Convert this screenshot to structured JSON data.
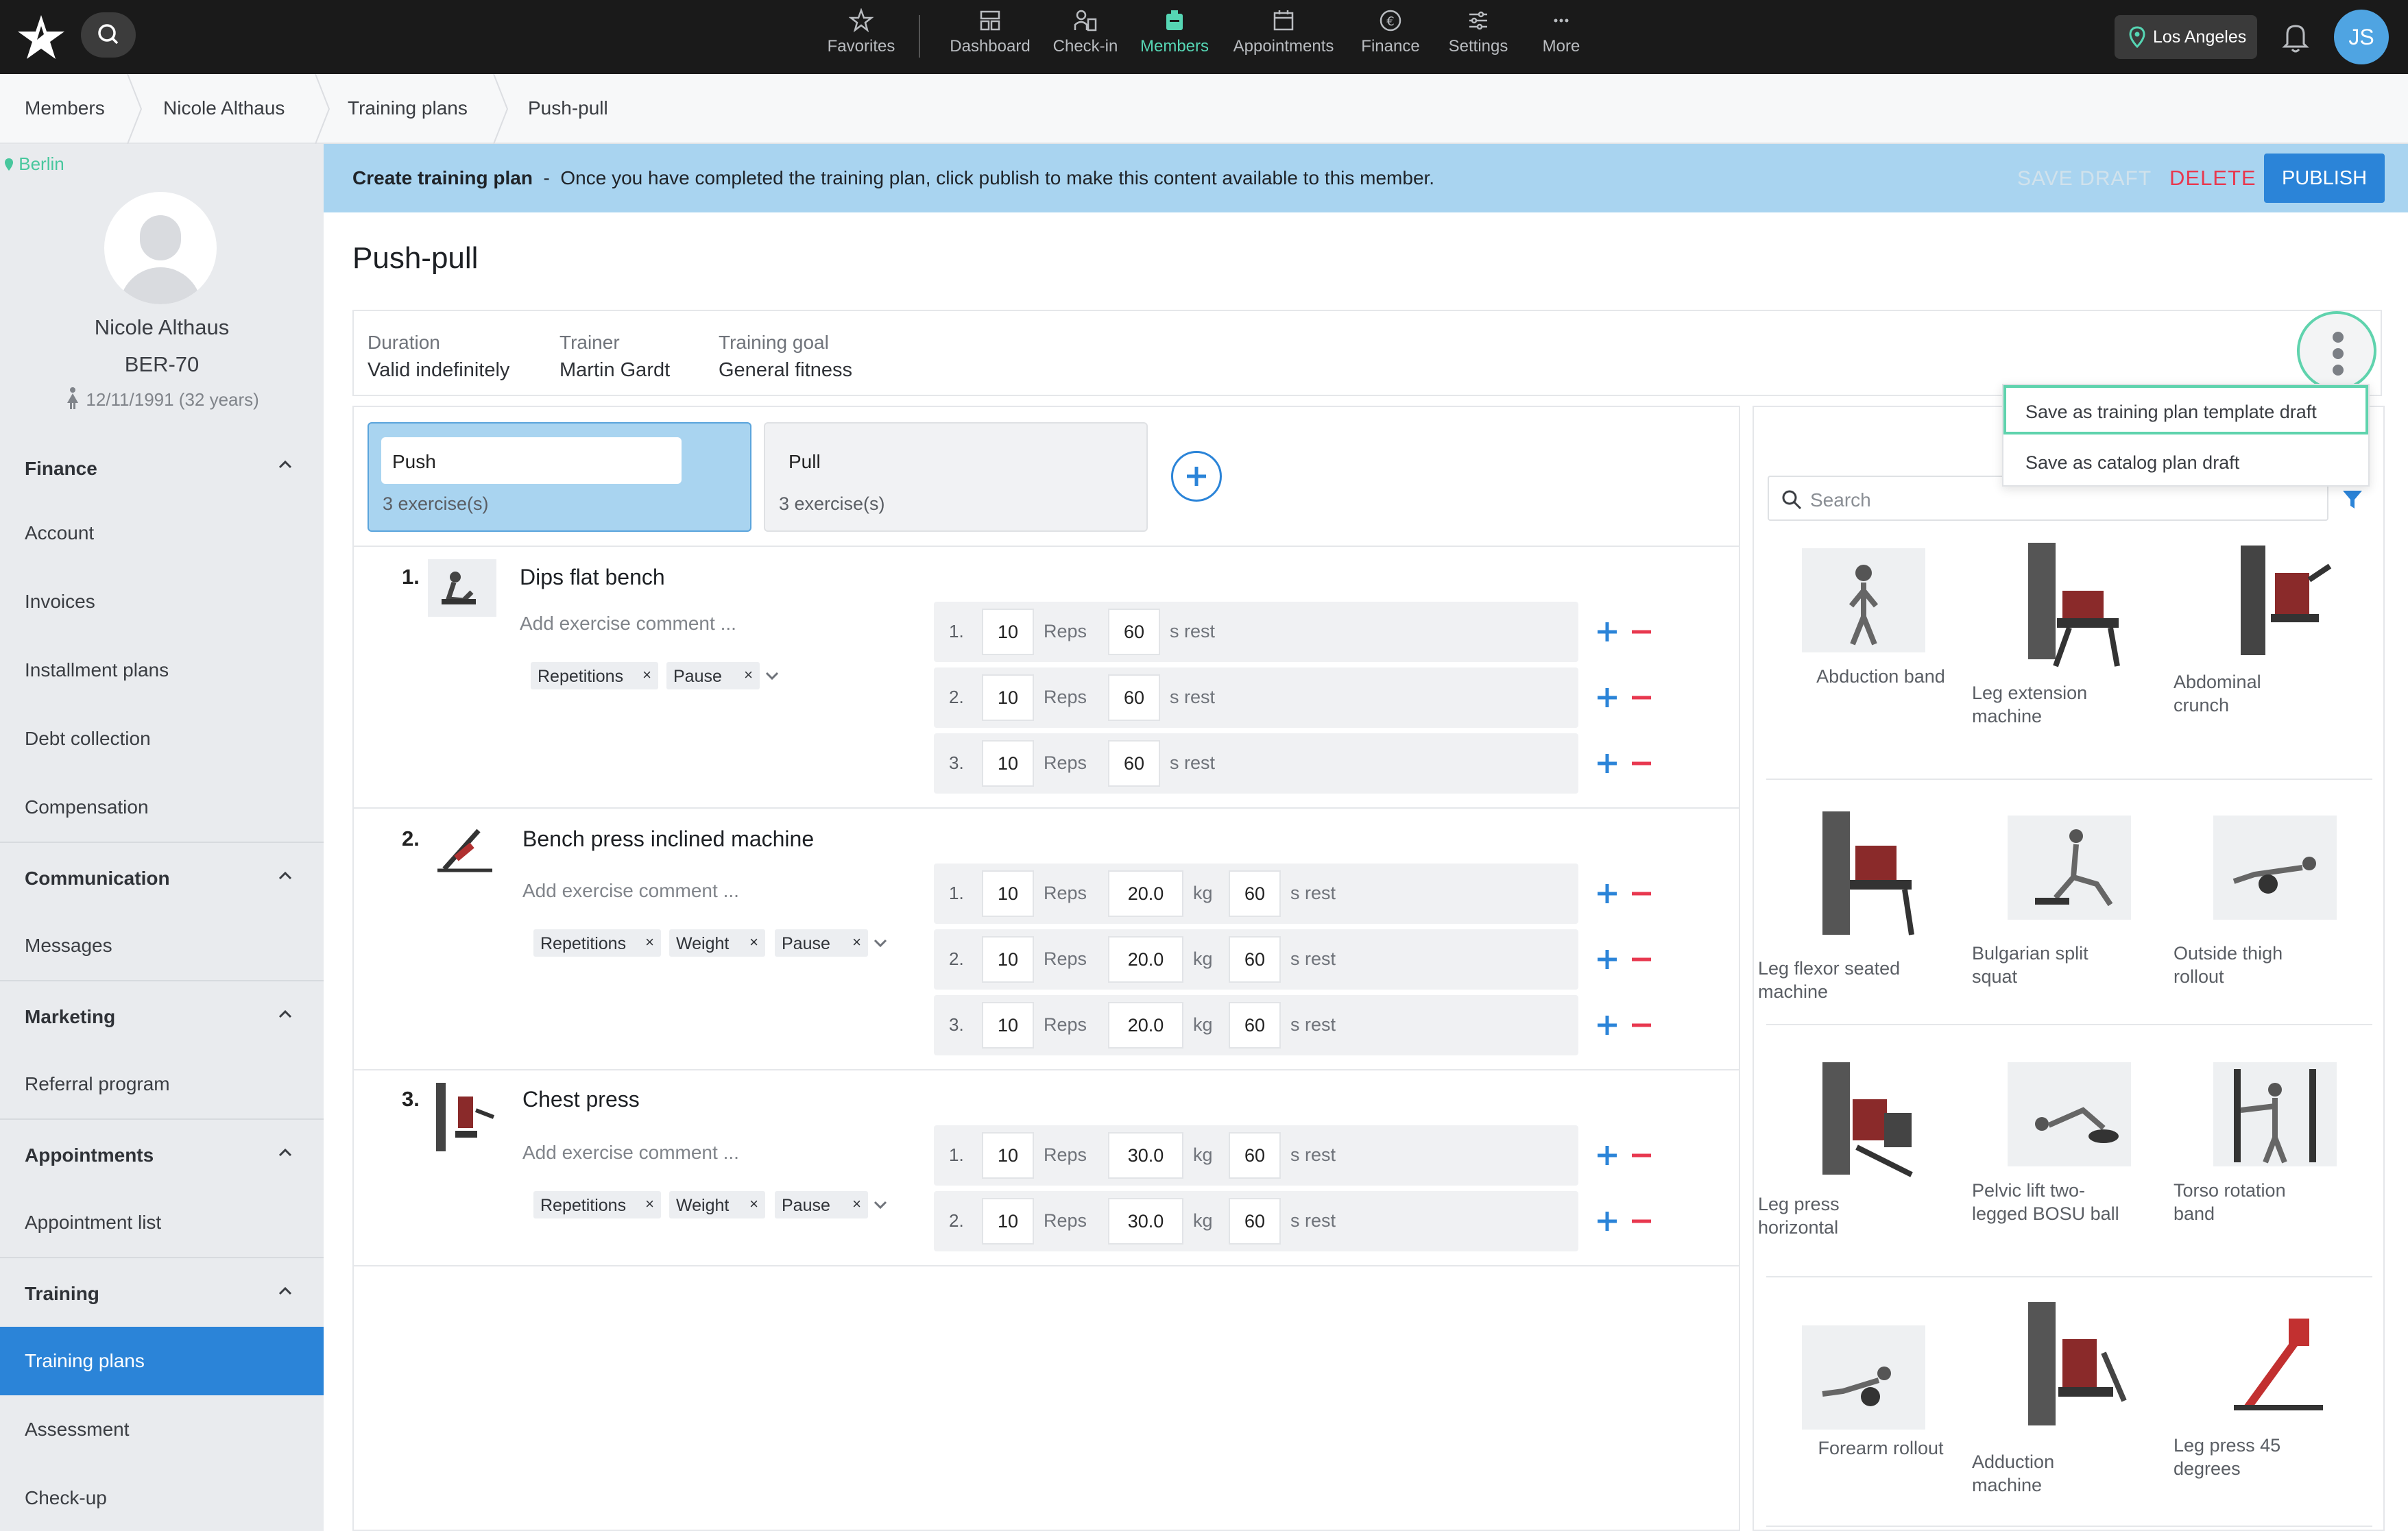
{
  "nav": {
    "items": [
      {
        "label": "Favorites",
        "icon": "star-icon"
      },
      {
        "label": "Dashboard",
        "icon": "dashboard-icon"
      },
      {
        "label": "Check-in",
        "icon": "checkin-icon"
      },
      {
        "label": "Members",
        "icon": "members-icon"
      },
      {
        "label": "Appointments",
        "icon": "calendar-icon"
      },
      {
        "label": "Finance",
        "icon": "euro-icon"
      },
      {
        "label": "Settings",
        "icon": "sliders-icon"
      },
      {
        "label": "More",
        "icon": "more-icon"
      }
    ],
    "location": "Los Angeles",
    "user_initials": "JS",
    "accent": "#56d6b4"
  },
  "breadcrumb": [
    "Members",
    "Nicole Althaus",
    "Training plans",
    "Push-pull"
  ],
  "sidebar": {
    "city": "Berlin",
    "member_name": "Nicole Althaus",
    "member_id": "BER-70",
    "dob": "12/11/1991 (32 years)",
    "sections": [
      {
        "title": "Finance",
        "items": [
          "Account",
          "Invoices",
          "Installment plans",
          "Debt collection",
          "Compensation"
        ]
      },
      {
        "title": "Communication",
        "items": [
          "Messages"
        ]
      },
      {
        "title": "Marketing",
        "items": [
          "Referral program"
        ]
      },
      {
        "title": "Appointments",
        "items": [
          "Appointment list"
        ]
      },
      {
        "title": "Training",
        "items": [
          "Training plans",
          "Assessment",
          "Check-up"
        ]
      }
    ],
    "active_item": "Training plans"
  },
  "infobar": {
    "title": "Create training plan",
    "sep": "-",
    "message": "Once you have completed the training plan, click publish to make this content available to this member.",
    "save_draft": "SAVE DRAFT",
    "delete": "DELETE",
    "publish": "PUBLISH"
  },
  "plan": {
    "title": "Push-pull",
    "meta": [
      {
        "key": "Duration",
        "value": "Valid indefinitely"
      },
      {
        "key": "Trainer",
        "value": "Martin Gardt"
      },
      {
        "key": "Training goal",
        "value": "General fitness"
      }
    ]
  },
  "menu": {
    "items": [
      "Save as training plan template draft",
      "Save as catalog plan draft"
    ]
  },
  "tabs": [
    {
      "name": "Push",
      "count": "3 exercise(s)"
    },
    {
      "name": "Pull",
      "count": "3 exercise(s)"
    }
  ],
  "exercises": [
    {
      "num": "1.",
      "name": "Dips flat bench",
      "comment_placeholder": "Add exercise comment ...",
      "chips": [
        "Repetitions",
        "Pause"
      ],
      "sets": [
        {
          "no": "1.",
          "reps": "10",
          "reps_unit": "Reps",
          "rest": "60",
          "rest_unit": "s rest"
        },
        {
          "no": "2.",
          "reps": "10",
          "reps_unit": "Reps",
          "rest": "60",
          "rest_unit": "s rest"
        },
        {
          "no": "3.",
          "reps": "10",
          "reps_unit": "Reps",
          "rest": "60",
          "rest_unit": "s rest"
        }
      ]
    },
    {
      "num": "2.",
      "name": "Bench press inclined machine",
      "comment_placeholder": "Add exercise comment ...",
      "chips": [
        "Repetitions",
        "Weight",
        "Pause"
      ],
      "sets": [
        {
          "no": "1.",
          "reps": "10",
          "reps_unit": "Reps",
          "weight": "20.0",
          "weight_unit": "kg",
          "rest": "60",
          "rest_unit": "s rest"
        },
        {
          "no": "2.",
          "reps": "10",
          "reps_unit": "Reps",
          "weight": "20.0",
          "weight_unit": "kg",
          "rest": "60",
          "rest_unit": "s rest"
        },
        {
          "no": "3.",
          "reps": "10",
          "reps_unit": "Reps",
          "weight": "20.0",
          "weight_unit": "kg",
          "rest": "60",
          "rest_unit": "s rest"
        }
      ]
    },
    {
      "num": "3.",
      "name": "Chest press",
      "comment_placeholder": "Add exercise comment ...",
      "chips": [
        "Repetitions",
        "Weight",
        "Pause"
      ],
      "sets": [
        {
          "no": "1.",
          "reps": "10",
          "reps_unit": "Reps",
          "weight": "30.0",
          "weight_unit": "kg",
          "rest": "60",
          "rest_unit": "s rest"
        },
        {
          "no": "2.",
          "reps": "10",
          "reps_unit": "Reps",
          "weight": "30.0",
          "weight_unit": "kg",
          "rest": "60",
          "rest_unit": "s rest"
        }
      ]
    }
  ],
  "library": {
    "search_placeholder": "Search",
    "items": [
      [
        "Abduction band"
      ],
      [
        "Leg extension",
        "machine"
      ],
      [
        "Abdominal",
        "crunch"
      ],
      [
        "Leg flexor seated",
        "machine"
      ],
      [
        "Bulgarian split",
        "squat"
      ],
      [
        "Outside thigh",
        "rollout"
      ],
      [
        "Leg press",
        "horizontal"
      ],
      [
        "Pelvic lift two-",
        "legged BOSU ball"
      ],
      [
        "Torso rotation",
        "band"
      ],
      [
        "Forearm rollout"
      ],
      [
        "Adduction",
        "machine"
      ],
      [
        "Leg press 45",
        "degrees"
      ]
    ]
  }
}
